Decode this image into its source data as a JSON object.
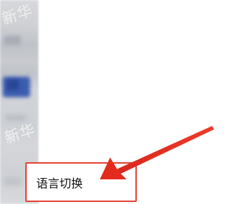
{
  "watermark": {
    "top_text": "新华",
    "bottom_text": "新华"
  },
  "menu": {
    "language_switch_label": "语言切换"
  },
  "annotation": {
    "highlight_color": "#e23a2c",
    "arrow_color": "#e32b1d",
    "arrow_icon": "red-pointer-arrow"
  }
}
